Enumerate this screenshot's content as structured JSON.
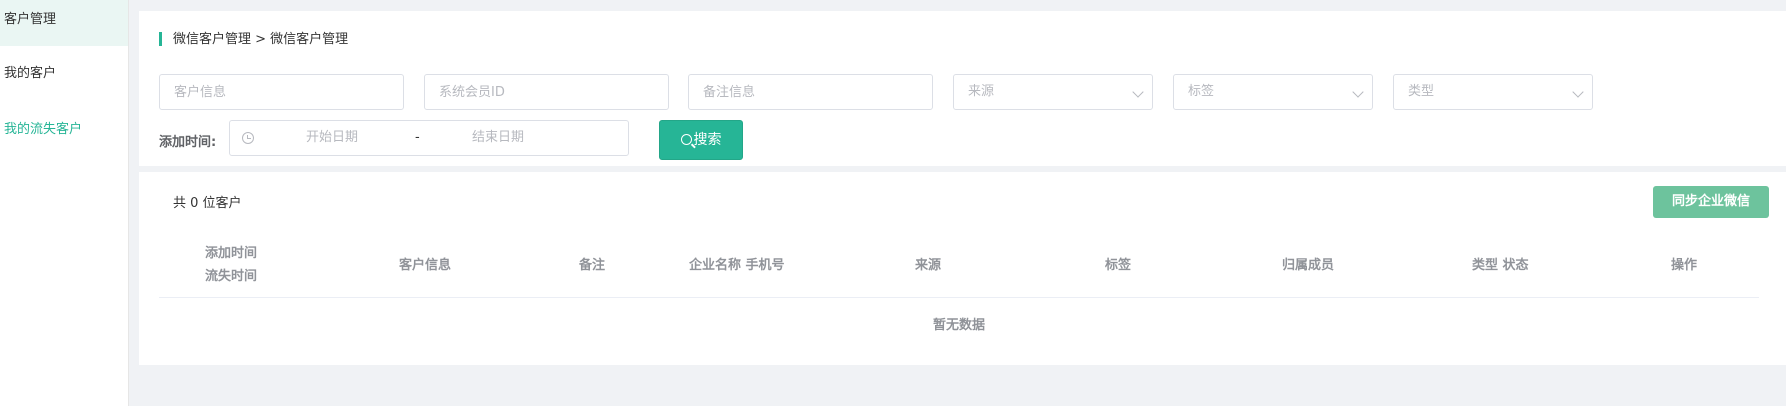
{
  "sidebar": {
    "items": [
      {
        "label": "客户管理"
      },
      {
        "label": "我的客户"
      },
      {
        "label": "我的流失客户"
      }
    ]
  },
  "breadcrumb": "微信客户管理 > 微信客户管理",
  "filters": {
    "customer_info_placeholder": "客户信息",
    "member_id_placeholder": "系统会员ID",
    "remark_placeholder": "备注信息",
    "source": "来源",
    "tag": "标签",
    "type": "类型",
    "add_time_label": "添加时间:",
    "start_date": "开始日期",
    "date_separator": "-",
    "end_date": "结束日期",
    "search_label": "搜索"
  },
  "summary": {
    "count_text": "共 0 位客户",
    "sync_label": "同步企业微信"
  },
  "table": {
    "columns": {
      "add_time": "添加时间",
      "lost_time": "流失时间",
      "customer_info": "客户信息",
      "remark": "备注",
      "company_phone": "企业名称 手机号",
      "source": "来源",
      "tag": "标签",
      "owner": "归属成员",
      "type_status": "类型 状态",
      "action": "操作"
    },
    "empty_text": "暂无数据"
  },
  "colors": {
    "accent": "#26b596",
    "sync_button": "#6dc39d"
  }
}
